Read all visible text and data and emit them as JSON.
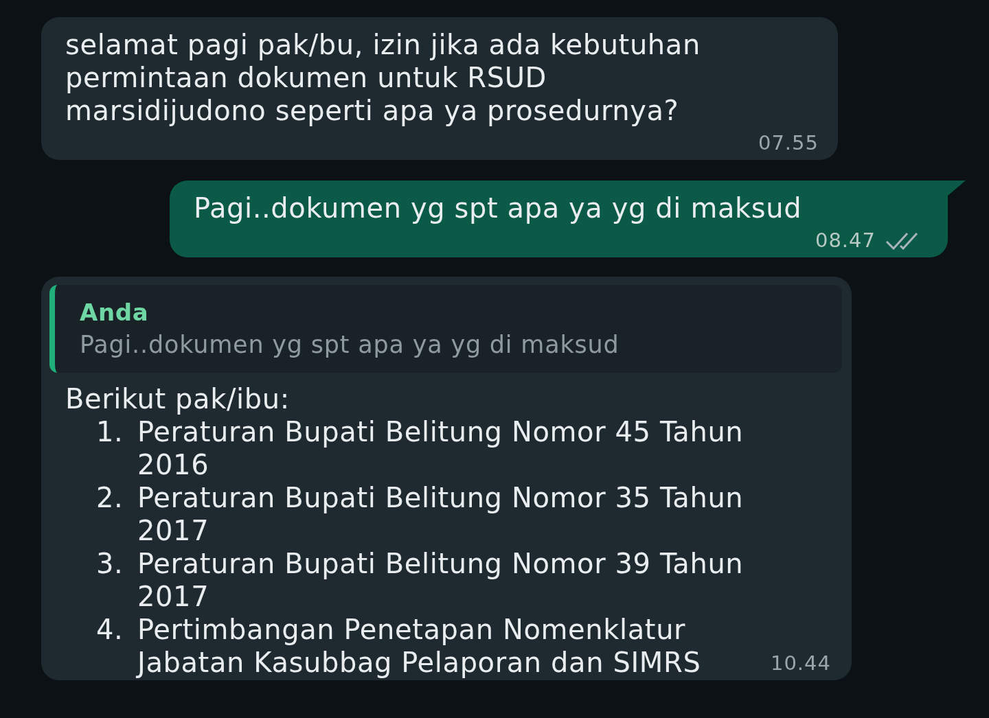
{
  "messages": [
    {
      "kind": "incoming",
      "text": "selamat pagi pak/bu, izin jika ada kebutuhan permintaan dokumen untuk RSUD marsidijudono seperti apa ya prosedurnya?",
      "time": "07.55"
    },
    {
      "kind": "outgoing",
      "text": "Pagi..dokumen yg spt apa ya yg di maksud",
      "time": "08.47",
      "read": false
    },
    {
      "kind": "incoming",
      "quote": {
        "author": "Anda",
        "text": "Pagi..dokumen yg spt apa ya yg di maksud"
      },
      "text": "Berikut pak/ibu:",
      "list": [
        {
          "number": "1.",
          "text": "Peraturan Bupati Belitung Nomor 45 Tahun 2016"
        },
        {
          "number": "2.",
          "text": "Peraturan Bupati Belitung Nomor 35 Tahun 2017"
        },
        {
          "number": "3.",
          "text": "Peraturan Bupati Belitung Nomor 39 Tahun 2017"
        },
        {
          "number": "4.",
          "text": "Pertimbangan Penetapan Nomenklatur Jabatan Kasubbag Pelaporan dan SIMRS"
        }
      ],
      "time": "10.44"
    }
  ]
}
